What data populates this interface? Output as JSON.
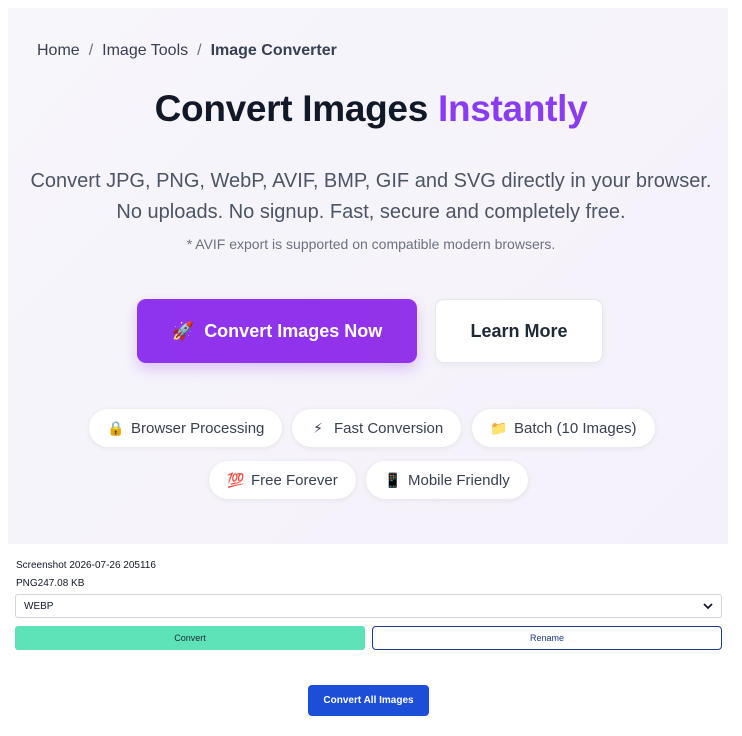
{
  "breadcrumb": {
    "items": [
      "Home",
      "Image Tools"
    ],
    "separator": "/",
    "current": "Image Converter"
  },
  "hero": {
    "title_main": "Convert Images",
    "title_accent": "Instantly",
    "subtitle_line1": "Convert JPG, PNG, WebP, AVIF, BMP, GIF and SVG directly in your browser.",
    "subtitle_line2": "No uploads. No signup. Fast, secure and completely free.",
    "note": "* AVIF export is supported on compatible modern browsers."
  },
  "buttons": {
    "primary_icon": "🚀",
    "primary_label": "Convert Images Now",
    "secondary_label": "Learn More"
  },
  "features": [
    {
      "icon": "🔒",
      "label": "Browser Processing"
    },
    {
      "icon": "⚡",
      "label": "Fast Conversion"
    },
    {
      "icon": "📁",
      "label": "Batch (10 Images)"
    },
    {
      "icon": "💯",
      "label": "Free Forever"
    },
    {
      "icon": "📱",
      "label": "Mobile Friendly"
    }
  ],
  "file": {
    "name": "Screenshot 2026-07-26 205116",
    "meta": "PNG247.08 KB",
    "format_selected": "WEBP",
    "convert_label": "Convert",
    "rename_label": "Rename"
  },
  "convert_all_label": "Convert All Images",
  "colors": {
    "accent": "#8a3df0",
    "primary_button": "#9333ea",
    "convert_button": "#5ee3b9",
    "convert_all_button": "#1d4ed8"
  }
}
